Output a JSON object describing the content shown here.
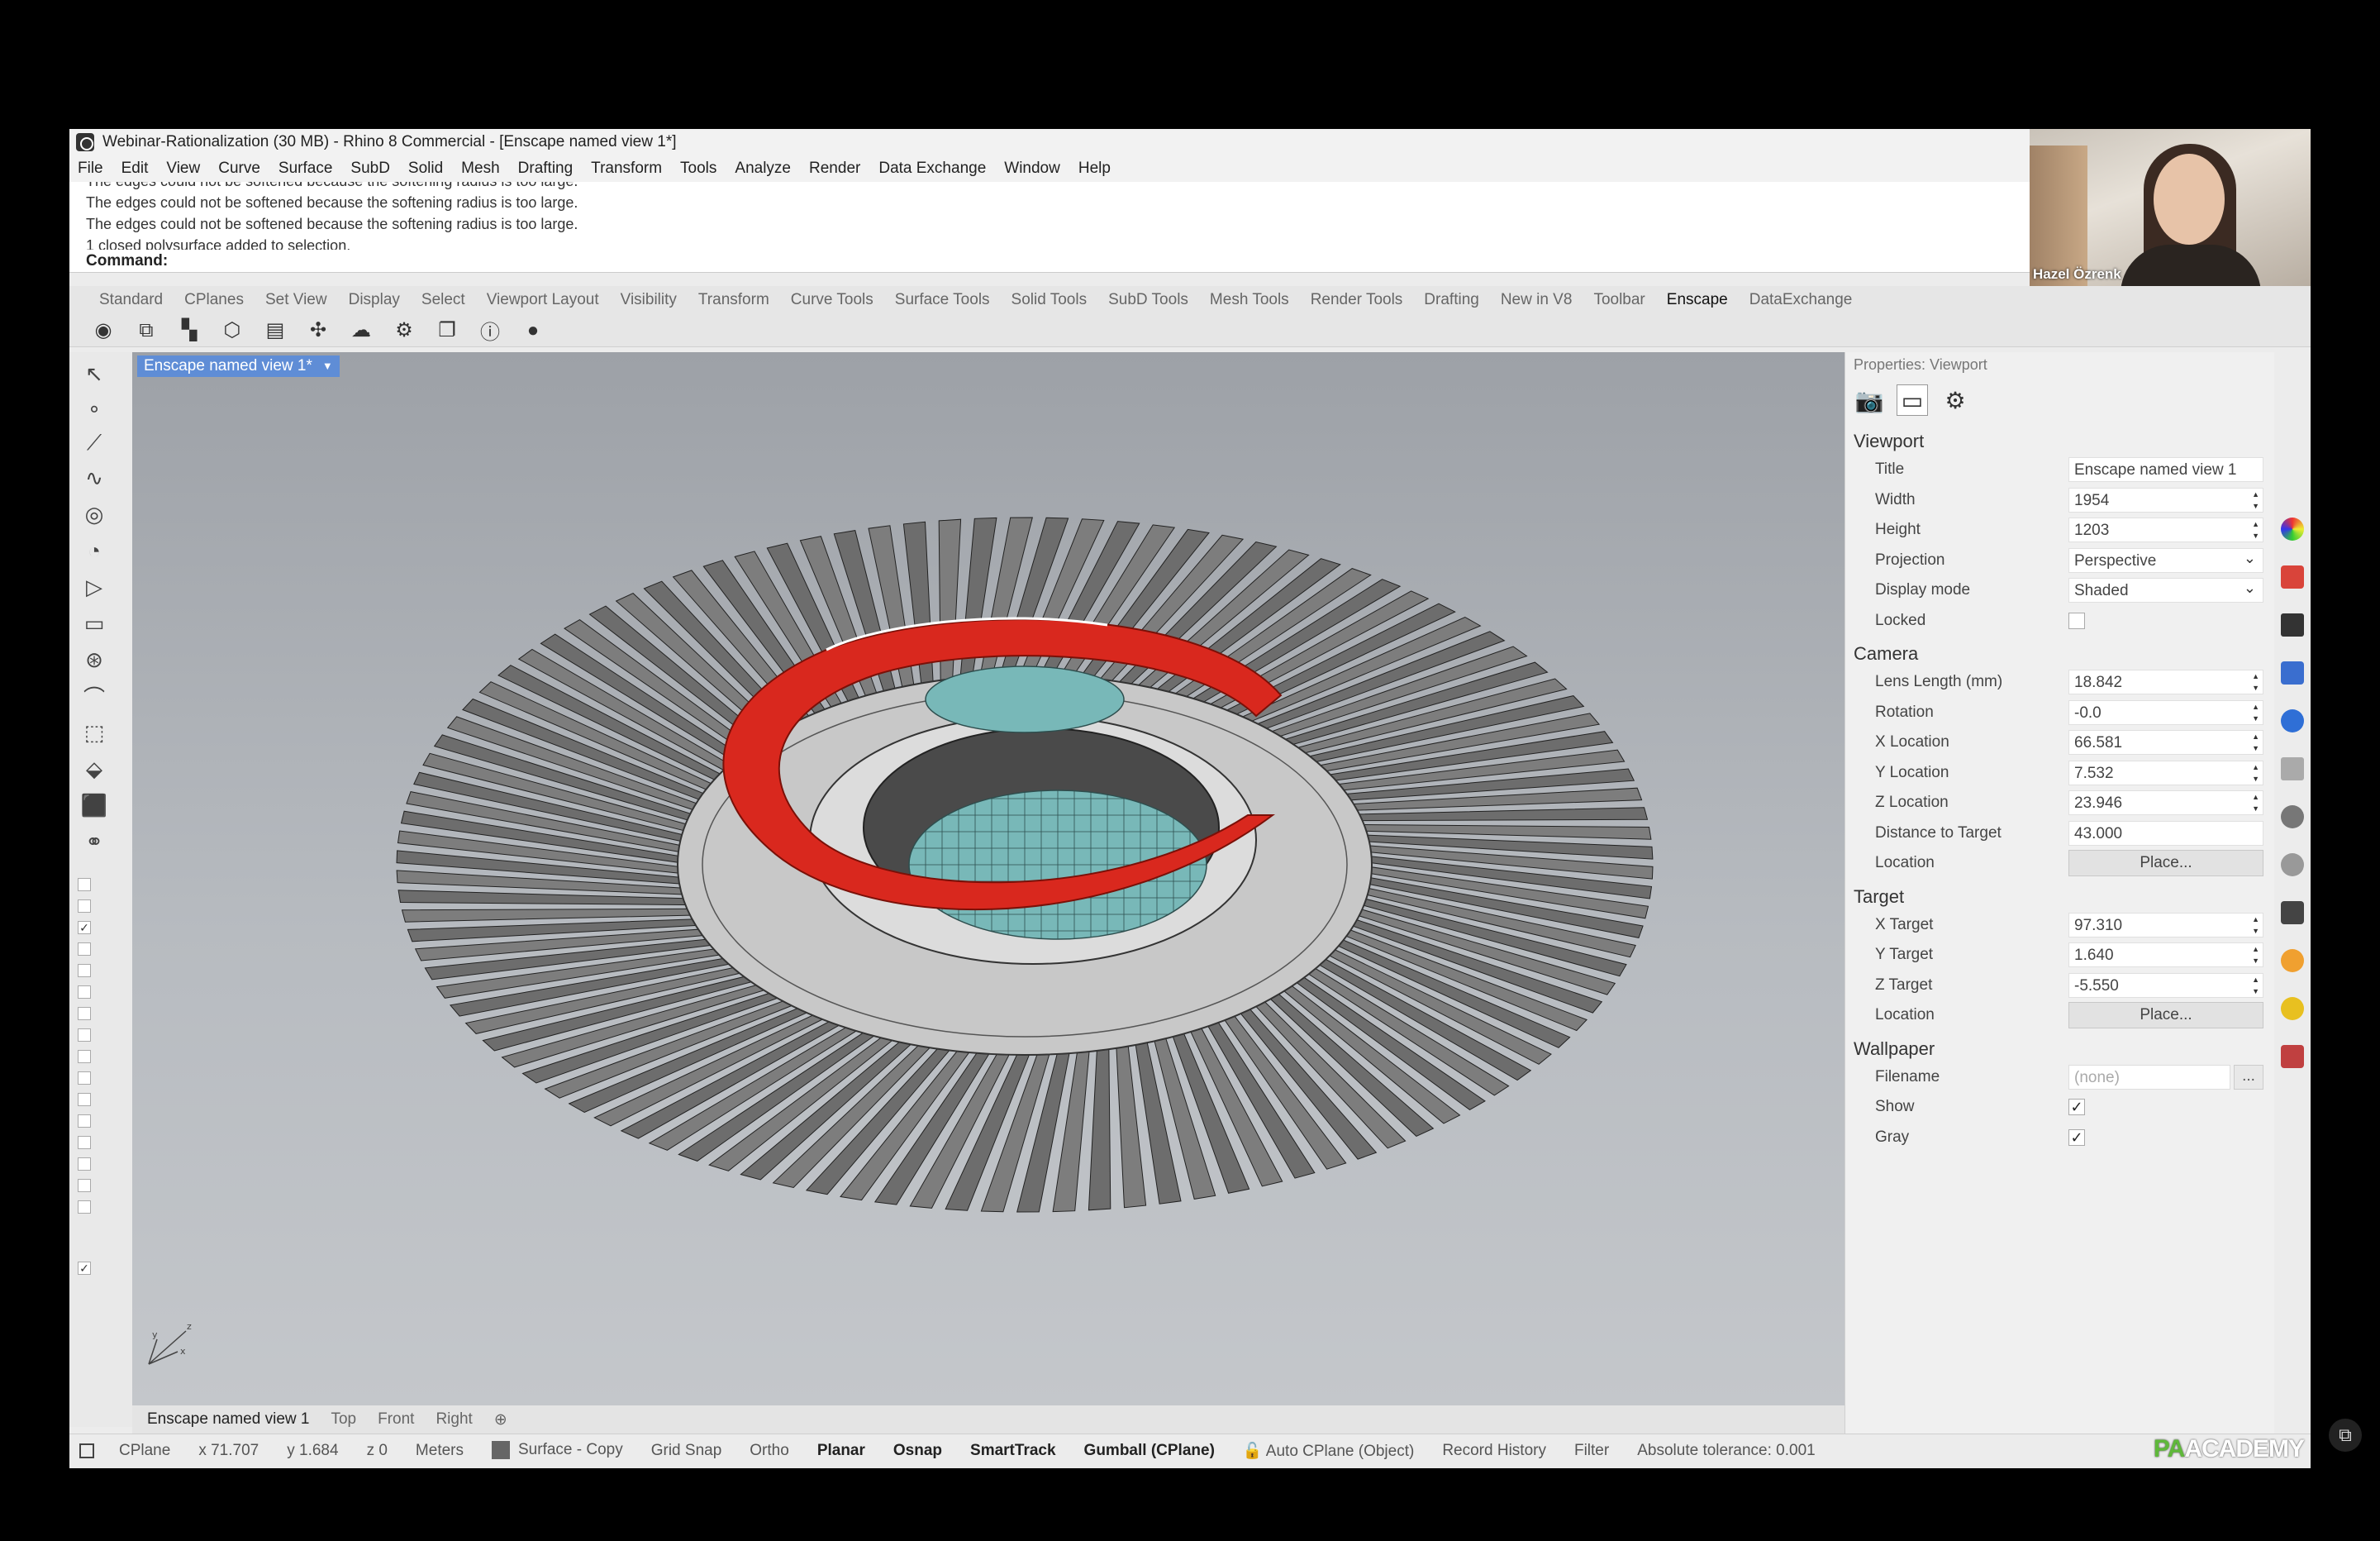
{
  "window": {
    "title": "Webinar-Rationalization (30 MB) - Rhino 8 Commercial - [Enscape named view 1*]"
  },
  "menu": [
    "File",
    "Edit",
    "View",
    "Curve",
    "Surface",
    "SubD",
    "Solid",
    "Mesh",
    "Drafting",
    "Transform",
    "Tools",
    "Analyze",
    "Render",
    "Data Exchange",
    "Window",
    "Help"
  ],
  "history": [
    "The edges could not be softened because the softening radius is too large.",
    "The edges could not be softened because the softening radius is too large.",
    "The edges could not be softened because the softening radius is too large.",
    "1 closed polysurface added to selection."
  ],
  "command_label": "Command:",
  "webcam": {
    "name": "Hazel Özrenk"
  },
  "toolbar_tabs": [
    "Standard",
    "CPlanes",
    "Set View",
    "Display",
    "Select",
    "Viewport Layout",
    "Visibility",
    "Transform",
    "Curve Tools",
    "Surface Tools",
    "Solid Tools",
    "SubD Tools",
    "Mesh Tools",
    "Render Tools",
    "Drafting",
    "New in V8",
    "Toolbar",
    "Enscape",
    "DataExchange"
  ],
  "active_tab": "Enscape",
  "toolbar_icons": [
    "enscape-start-icon",
    "enscape-sync-icon",
    "enscape-views-icon",
    "enscape-asset-icon",
    "enscape-library-icon",
    "enscape-upload-icon",
    "cloud-icon",
    "settings-icon",
    "window-icon",
    "info-icon",
    "account-icon"
  ],
  "viewport": {
    "tab_label": "Enscape named view 1*",
    "bottom_tabs": [
      "Enscape named view 1",
      "Top",
      "Front",
      "Right"
    ],
    "axis_labels": {
      "x": "x",
      "y": "y",
      "z": "z"
    }
  },
  "status": {
    "cplane": "CPlane",
    "x": "x 71.707",
    "y": "y 1.684",
    "z": "z 0",
    "units": "Meters",
    "layer": "Surface - Copy",
    "toggles": [
      {
        "label": "Grid Snap",
        "on": false
      },
      {
        "label": "Ortho",
        "on": false
      },
      {
        "label": "Planar",
        "on": true
      },
      {
        "label": "Osnap",
        "on": true
      },
      {
        "label": "SmartTrack",
        "on": true
      },
      {
        "label": "Gumball (CPlane)",
        "on": true
      },
      {
        "label": "Auto CPlane (Object)",
        "on": false
      },
      {
        "label": "Record History",
        "on": false
      },
      {
        "label": "Filter",
        "on": false
      }
    ],
    "tolerance": "Absolute tolerance: 0.001",
    "brand_pa": "PA",
    "brand_rest": "ACADEMY"
  },
  "panel": {
    "header": "Properties: Viewport",
    "viewport_section": "Viewport",
    "title_label": "Title",
    "title_value": "Enscape named view 1",
    "width_label": "Width",
    "width_value": "1954",
    "height_label": "Height",
    "height_value": "1203",
    "projection_label": "Projection",
    "projection_value": "Perspective",
    "display_label": "Display mode",
    "display_value": "Shaded",
    "locked_label": "Locked",
    "camera_section": "Camera",
    "lens_label": "Lens Length (mm)",
    "lens_value": "18.842",
    "rotation_label": "Rotation",
    "rotation_value": "-0.0",
    "xloc_label": "X Location",
    "xloc_value": "66.581",
    "yloc_label": "Y Location",
    "yloc_value": "7.532",
    "zloc_label": "Z Location",
    "zloc_value": "23.946",
    "dist_label": "Distance to Target",
    "dist_value": "43.000",
    "loc_label": "Location",
    "place_label": "Place...",
    "target_section": "Target",
    "xt_label": "X Target",
    "xt_value": "97.310",
    "yt_label": "Y Target",
    "yt_value": "1.640",
    "zt_label": "Z Target",
    "zt_value": "-5.550",
    "tloc_label": "Location",
    "tplace_label": "Place...",
    "wallpaper_section": "Wallpaper",
    "filename_label": "Filename",
    "filename_value": "(none)",
    "browse_label": "...",
    "show_label": "Show",
    "gray_label": "Gray",
    "check_mark": "✓"
  },
  "colors": {
    "accent_tab": "#5f8dd6",
    "model_red": "#d9281e",
    "model_teal": "#78b8b8"
  }
}
